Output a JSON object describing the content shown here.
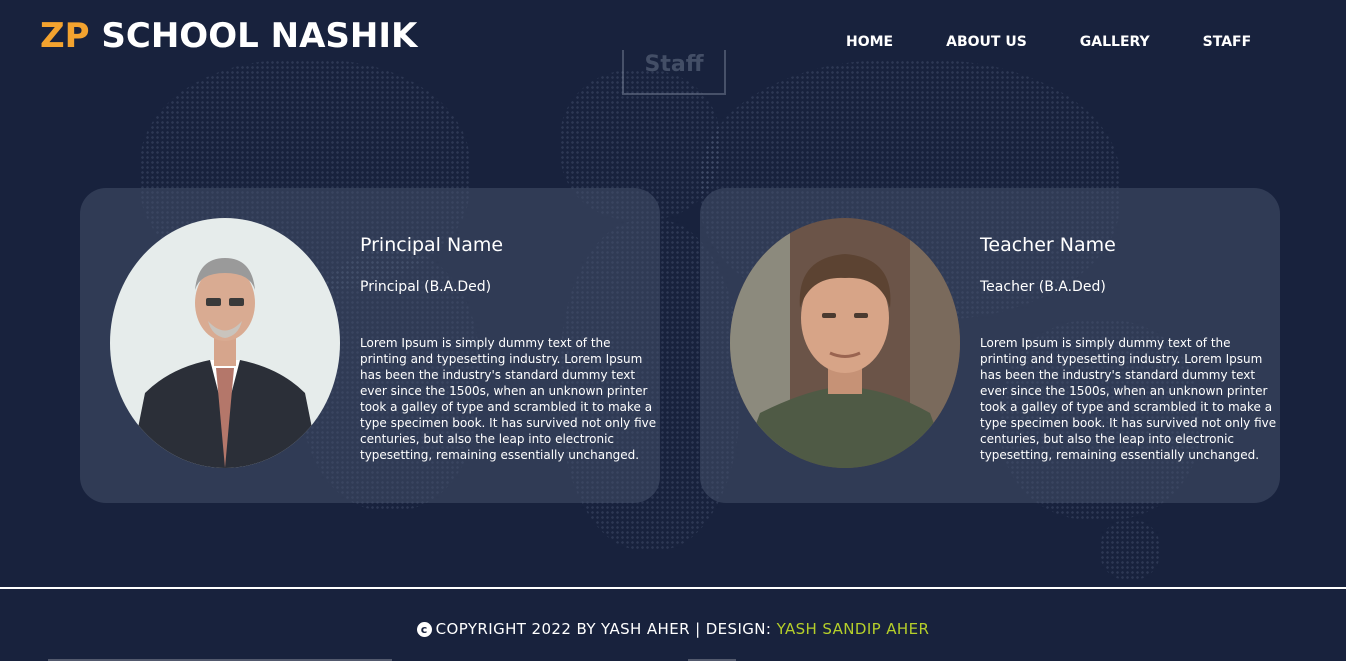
{
  "header": {
    "brand_prefix": "ZP",
    "brand_rest": " SCHOOL NASHIK",
    "nav": [
      {
        "label": "HOME"
      },
      {
        "label": "ABOUT US"
      },
      {
        "label": "GALLERY"
      },
      {
        "label": "STAFF"
      }
    ]
  },
  "main": {
    "section_heading": "Staff",
    "cards": [
      {
        "name": "Principal Name",
        "role": "Principal (B.A.Ded)",
        "description": "Lorem Ipsum is simply dummy text of the printing and typesetting industry. Lorem Ipsum has been the industry's standard dummy text ever since the 1500s, when an unknown printer took a galley of type and scrambled it to make a type specimen book. It has survived not only five centuries, but also the leap into electronic typesetting, remaining essentially unchanged.",
        "photo_icon": "principal-portrait"
      },
      {
        "name": "Teacher Name",
        "role": "Teacher (B.A.Ded)",
        "description": "Lorem Ipsum is simply dummy text of the printing and typesetting industry. Lorem Ipsum has been the industry's standard dummy text ever since the 1500s, when an unknown printer took a galley of type and scrambled it to make a type specimen book. It has survived not only five centuries, but also the leap into electronic typesetting, remaining essentially unchanged.",
        "photo_icon": "teacher-portrait"
      }
    ]
  },
  "footer": {
    "copyright_symbol": "c",
    "copyright_text": "COPYRIGHT 2022 BY YASH AHER | DESIGN: ",
    "designer": "YASH SANDIP AHER"
  },
  "colors": {
    "background": "#18223d",
    "brand_accent": "#f3a32f",
    "designer_link": "#b5cf2a",
    "card_bg": "rgba(70,80,105,0.55)"
  }
}
